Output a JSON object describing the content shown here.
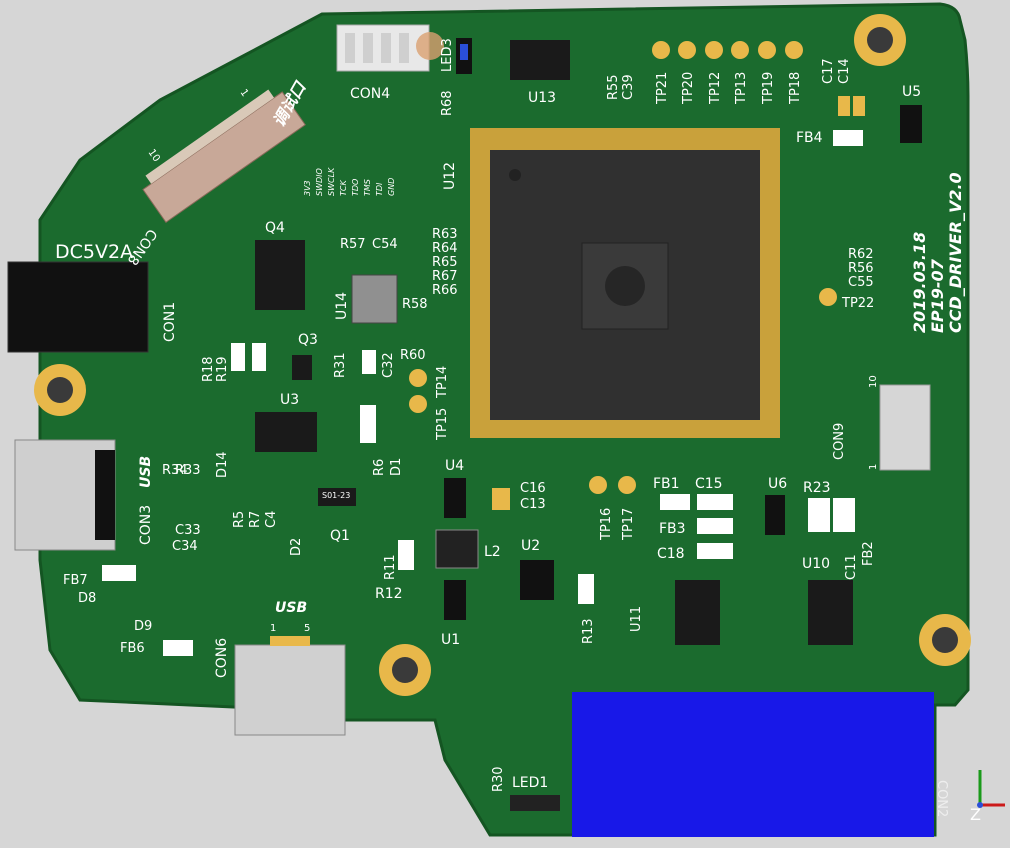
{
  "board": {
    "name": "CCD_DRIVER_V2.0",
    "project": "EP19-07",
    "date": "2019.03.18",
    "power_label": "DC5V2A",
    "debug_label": "调试口",
    "usb_label": "USB",
    "usb_label_top": "USB",
    "swd_pins": [
      "3V3",
      "SWDIO",
      "SWCLK",
      "TCK",
      "TDO",
      "TMS",
      "TDI",
      "GND"
    ]
  },
  "designators": {
    "CON1": "CON1",
    "CON2": "CON2",
    "CON3": "CON3",
    "CON4": "CON4",
    "CON6": "CON6",
    "CON8": "CON8",
    "CON9": "CON9",
    "U1": "U1",
    "U2": "U2",
    "U3": "U3",
    "U4": "U4",
    "U5": "U5",
    "U6": "U6",
    "U10": "U10",
    "U11": "U11",
    "U12": "U12",
    "U13": "U13",
    "U14": "U14",
    "Q1": "Q1",
    "Q3": "Q3",
    "Q4": "Q4",
    "L2": "L2",
    "LED1": "LED1",
    "LED3": "LED3",
    "D1": "D1",
    "D2": "D2",
    "D8": "D8",
    "D9": "D9",
    "D14": "D14",
    "FB1": "FB1",
    "FB2": "FB2",
    "FB3": "FB3",
    "FB4": "FB4",
    "FB6": "FB6",
    "FB7": "FB7",
    "C4": "C4",
    "C11": "C11",
    "C13": "C13",
    "C14": "C14",
    "C15": "C15",
    "C16": "C16",
    "C17": "C17",
    "C18": "C18",
    "C32": "C32",
    "C33": "C33",
    "C34": "C34",
    "C39": "C39",
    "C54": "C54",
    "C55": "C55",
    "R5": "R5",
    "R6": "R6",
    "R7": "R7",
    "R11": "R11",
    "R12": "R12",
    "R13": "R13",
    "R18": "R18",
    "R19": "R19",
    "R23": "R23",
    "R30": "R30",
    "R31": "R31",
    "R33": "R33",
    "R34": "R34",
    "R55": "R55",
    "R56": "R56",
    "R57": "R57",
    "R58": "R58",
    "R60": "R60",
    "R62": "R62",
    "R63": "R63",
    "R64": "R64",
    "R65": "R65",
    "R66": "R66",
    "R67": "R67",
    "R68": "R68",
    "TP12": "TP12",
    "TP13": "TP13",
    "TP14": "TP14",
    "TP15": "TP15",
    "TP16": "TP16",
    "TP17": "TP17",
    "TP18": "TP18",
    "TP19": "TP19",
    "TP20": "TP20",
    "TP21": "TP21",
    "TP22": "TP22"
  },
  "part_marks": {
    "q1": "S01-23"
  },
  "pin_marks": {
    "con8_10": "10",
    "con8_1": "1",
    "con9_10": "10",
    "con9_1": "1",
    "con6_1": "1",
    "con6_5": "5"
  },
  "axes": {
    "z_label": "Z"
  },
  "colors": {
    "pcb": "#1b6b2e",
    "pcb_edge": "#145522",
    "gold": "#e8b84a",
    "silk": "#ffffff",
    "block": "#1818e8"
  }
}
